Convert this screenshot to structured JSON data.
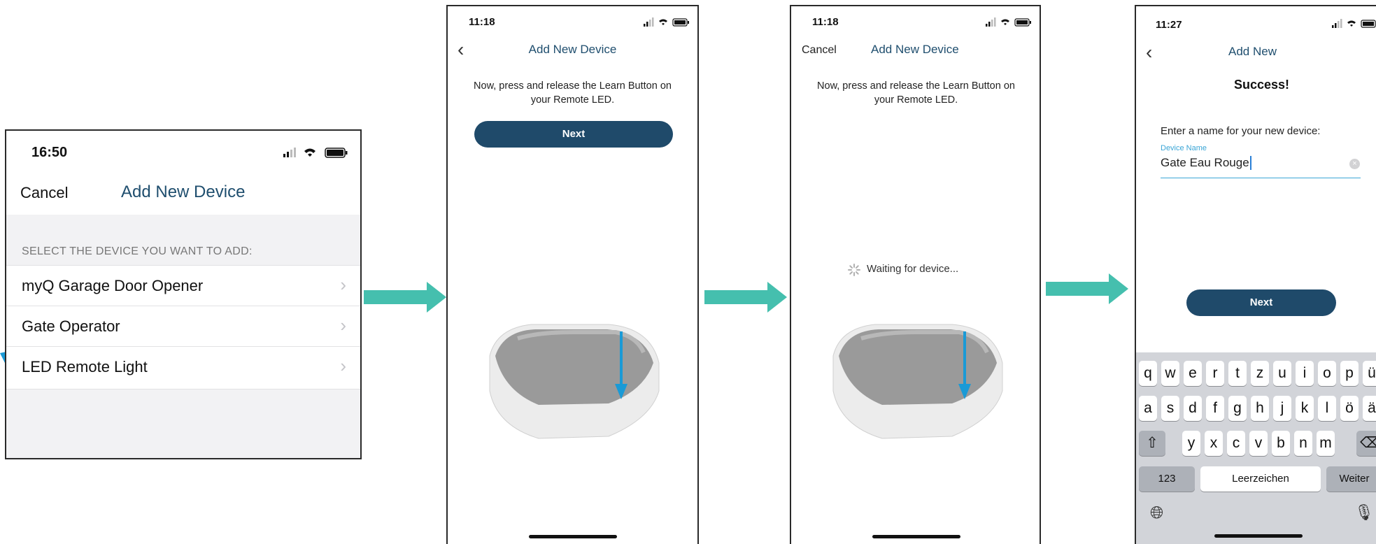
{
  "screen1": {
    "time": "16:50",
    "cancel": "Cancel",
    "title": "Add New Device",
    "section_header": "SELECT THE DEVICE YOU WANT TO ADD:",
    "items": [
      {
        "label": "myQ Garage Door Opener"
      },
      {
        "label": "Gate Operator"
      },
      {
        "label": "LED Remote Light"
      }
    ]
  },
  "screen2": {
    "time": "11:18",
    "title": "Add New Device",
    "instruction": "Now, press and release the Learn Button on your Remote LED.",
    "next": "Next"
  },
  "screen3": {
    "time": "11:18",
    "cancel": "Cancel",
    "title": "Add New Device",
    "instruction": "Now, press and release the Learn Button on your Remote LED.",
    "waiting": "Waiting for device..."
  },
  "screen4": {
    "time": "11:27",
    "title": "Add New",
    "success": "Success!",
    "prompt": "Enter a name for your new device:",
    "field_label": "Device Name",
    "field_value": "Gate Eau Rouge",
    "next": "Next",
    "keyboard": {
      "row1": [
        "q",
        "w",
        "e",
        "r",
        "t",
        "z",
        "u",
        "i",
        "o",
        "p",
        "ü"
      ],
      "row2": [
        "a",
        "s",
        "d",
        "f",
        "g",
        "h",
        "j",
        "k",
        "l",
        "ö",
        "ä"
      ],
      "row3": [
        "y",
        "x",
        "c",
        "v",
        "b",
        "n",
        "m"
      ],
      "numbers": "123",
      "space": "Leerzeichen",
      "return": "Weiter"
    }
  },
  "colors": {
    "arrow": "#45bfae",
    "accent": "#1f4a6a",
    "pointer": "#1a9ad6"
  }
}
